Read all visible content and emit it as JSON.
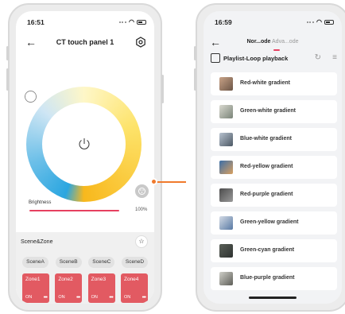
{
  "left_phone": {
    "status_time": "16:51",
    "title": "CT touch panel 1",
    "brightness_label": "Brightness",
    "brightness_value": "100%",
    "scene_zone_title": "Scene&Zone",
    "scenes": [
      "SceneA",
      "SceneB",
      "SceneC",
      "SceneD"
    ],
    "zones": [
      {
        "name": "Zone1",
        "state": "ON",
        "more": "•••"
      },
      {
        "name": "Zone2",
        "state": "ON",
        "more": "•••"
      },
      {
        "name": "Zone3",
        "state": "ON",
        "more": "•••"
      },
      {
        "name": "Zone4",
        "state": "ON",
        "more": "•••"
      }
    ],
    "brightness_level": 1.0,
    "accent_color": "#e64060",
    "zone_color": "#e25a62"
  },
  "right_phone": {
    "status_time": "16:59",
    "tab_active": "Nor...ode",
    "tab_inactive": "Adva...ode",
    "playlist_title": "Playlist-Loop playback",
    "items": [
      {
        "label": "Red-white gradient",
        "thumb": "#a9826a"
      },
      {
        "label": "Green-white gradient",
        "thumb": "#9aa69a"
      },
      {
        "label": "Blue-white gradient",
        "thumb": "#7d8fa6"
      },
      {
        "label": "Red-yellow gradient",
        "thumb": "#b79a6e"
      },
      {
        "label": "Red-purple gradient",
        "thumb": "#6f6a6a"
      },
      {
        "label": "Green-yellow gradient",
        "thumb": "#8a9bb3"
      },
      {
        "label": "Green-cyan gradient",
        "thumb": "#6d7470"
      },
      {
        "label": "Blue-purple gradient",
        "thumb": "#8a8a86"
      }
    ]
  },
  "connector_color": "#f07a2d"
}
